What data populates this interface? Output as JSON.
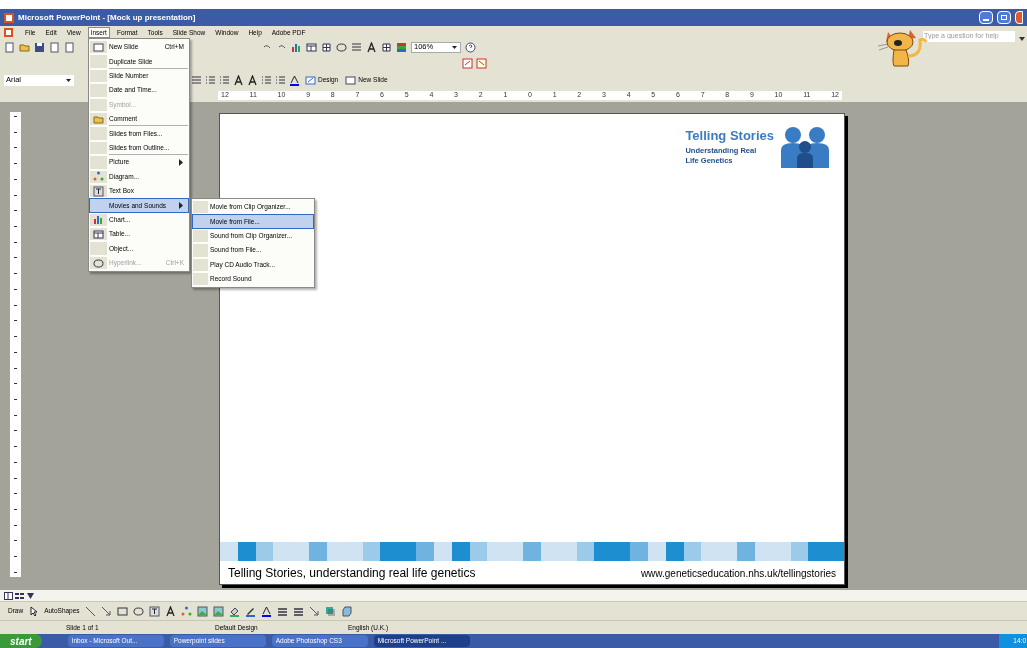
{
  "window": {
    "title": "Microsoft PowerPoint - [Mock up presentation]"
  },
  "menu_bar": [
    {
      "label": "File",
      "selected": false
    },
    {
      "label": "Edit",
      "selected": false
    },
    {
      "label": "View",
      "selected": false
    },
    {
      "label": "Insert",
      "selected": true
    },
    {
      "label": "Format",
      "selected": false
    },
    {
      "label": "Tools",
      "selected": false
    },
    {
      "label": "Slide Show",
      "selected": false
    },
    {
      "label": "Window",
      "selected": false
    },
    {
      "label": "Help",
      "selected": false
    },
    {
      "label": "Adobe PDF",
      "selected": false
    }
  ],
  "help_box": {
    "placeholder": "Type a question for help"
  },
  "standard_toolbar": {
    "zoom": "106%"
  },
  "formatting_toolbar": {
    "font": "Arial",
    "design_button": "Design",
    "new_slide_button": "New Slide"
  },
  "ruler": {
    "labels": [
      "12",
      "11",
      "10",
      "9",
      "8",
      "7",
      "6",
      "5",
      "4",
      "3",
      "2",
      "1",
      "0",
      "1",
      "2",
      "3",
      "4",
      "5",
      "6",
      "7",
      "8",
      "9",
      "10",
      "11",
      "12"
    ]
  },
  "insert_menu": [
    {
      "label": "New Slide",
      "shortcut": "Ctrl+M",
      "disabled": false,
      "selected": false,
      "submenu": false,
      "separator_after": false
    },
    {
      "label": "Duplicate Slide",
      "disabled": false,
      "selected": false,
      "submenu": false,
      "separator_after": true
    },
    {
      "label": "Slide Number",
      "disabled": false,
      "selected": false,
      "submenu": false,
      "separator_after": false
    },
    {
      "label": "Date and Time...",
      "disabled": false,
      "selected": false,
      "submenu": false,
      "separator_after": false
    },
    {
      "label": "Symbol...",
      "disabled": true,
      "selected": false,
      "submenu": false,
      "separator_after": false
    },
    {
      "label": "Comment",
      "disabled": false,
      "selected": false,
      "submenu": false,
      "separator_after": true
    },
    {
      "label": "Slides from Files...",
      "disabled": false,
      "selected": false,
      "submenu": false,
      "separator_after": false
    },
    {
      "label": "Slides from Outline...",
      "disabled": false,
      "selected": false,
      "submenu": false,
      "separator_after": true
    },
    {
      "label": "Picture",
      "disabled": false,
      "selected": false,
      "submenu": true,
      "separator_after": false
    },
    {
      "label": "Diagram...",
      "disabled": false,
      "selected": false,
      "submenu": false,
      "separator_after": false
    },
    {
      "label": "Text Box",
      "disabled": false,
      "selected": false,
      "submenu": false,
      "separator_after": false
    },
    {
      "label": "Movies and Sounds",
      "disabled": false,
      "selected": true,
      "submenu": true,
      "separator_after": false
    },
    {
      "label": "Chart...",
      "disabled": false,
      "selected": false,
      "submenu": false,
      "separator_after": false
    },
    {
      "label": "Table...",
      "disabled": false,
      "selected": false,
      "submenu": false,
      "separator_after": false
    },
    {
      "label": "Object...",
      "disabled": false,
      "selected": false,
      "submenu": false,
      "separator_after": false
    },
    {
      "label": "Hyperlink...",
      "shortcut": "Ctrl+K",
      "disabled": true,
      "selected": false,
      "submenu": false,
      "separator_after": false
    }
  ],
  "movies_submenu": [
    {
      "label": "Movie from Clip Organizer...",
      "selected": false
    },
    {
      "label": "Movie from File...",
      "selected": true
    },
    {
      "label": "Sound from Clip Organizer...",
      "selected": false
    },
    {
      "label": "Sound from File...",
      "selected": false
    },
    {
      "label": "Play CD Audio Track...",
      "selected": false
    },
    {
      "label": "Record Sound",
      "selected": false
    }
  ],
  "slide": {
    "logo_title": "Telling Stories",
    "logo_subtitle": "Understanding Real Life Genetics",
    "footer_left": "Telling Stories, understanding real life genetics",
    "footer_right": "www.geneticseducation.nhs.uk/tellingstories"
  },
  "drawing_toolbar": {
    "draw": "Draw",
    "autoshapes": "AutoShapes"
  },
  "status_bar": [
    "Slide 1 of 1",
    "Default Design",
    "English (U.K.)"
  ],
  "taskbar": {
    "start": "start",
    "tasks": [
      {
        "label": "Inbox - Microsoft Out...",
        "selected": false
      },
      {
        "label": "Powerpoint slides",
        "selected": false
      },
      {
        "label": "Adobe Photoshop CS3",
        "selected": false
      },
      {
        "label": "Microsoft PowerPoint ...",
        "selected": true
      }
    ],
    "clock": "14:0"
  }
}
